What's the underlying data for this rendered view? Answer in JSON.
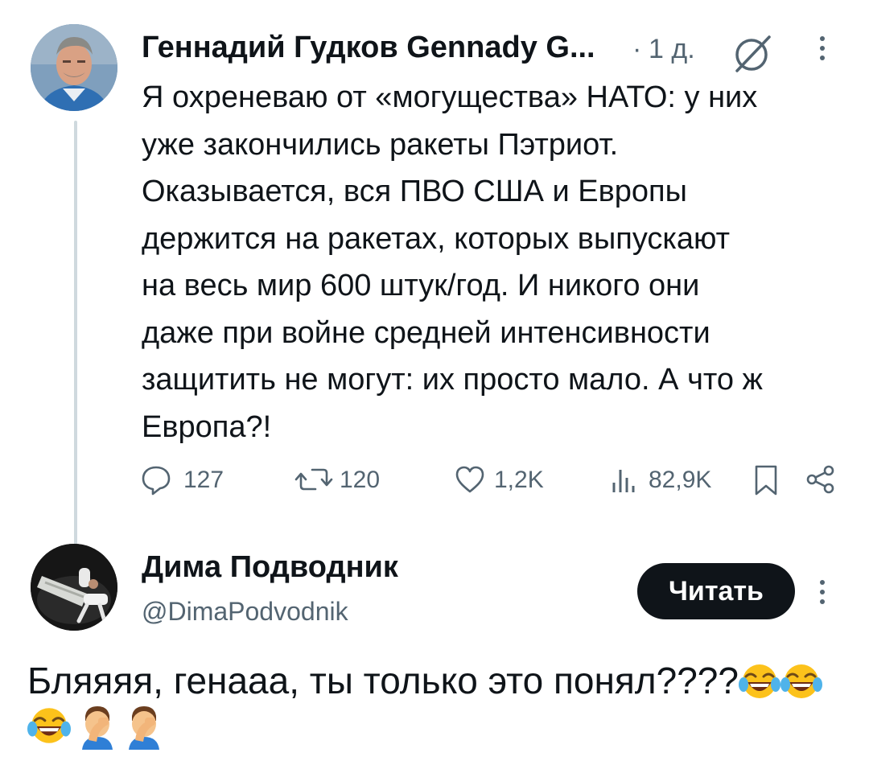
{
  "tweet": {
    "author_name": "Геннадий Гудков Gennady G...",
    "separator": "·",
    "time": "1 д.",
    "text_lines": [
      "Я охреневаю от «могущества» НАТО: у них",
      "уже закончились ракеты Пэтриот.",
      "Оказывается, вся ПВО США и Европы",
      "держится на ракетах, которых выпускают",
      "на весь мир 600 штук/год. И никого они",
      "даже при войне средней интенсивности",
      "защитить не могут: их просто мало.  А что ж",
      "Европа?!"
    ],
    "actions": {
      "replies": "127",
      "reposts": "120",
      "likes": "1,2K",
      "views": "82,9K"
    },
    "icons": {
      "grok": "grok-icon",
      "more": "more-vertical-icon",
      "reply": "reply-icon",
      "repost": "repost-icon",
      "like": "heart-icon",
      "views": "views-icon",
      "bookmark": "bookmark-icon",
      "share": "share-icon"
    }
  },
  "reply": {
    "author_name": "Дима Подводник",
    "handle": "@DimaPodvodnik",
    "follow_label": "Читать",
    "text": "Бляяяя, генааа, ты только это понял????",
    "emojis": [
      "face-with-tears-of-joy",
      "face-with-tears-of-joy",
      "face-with-tears-of-joy",
      "man-facepalming",
      "man-facepalming"
    ]
  },
  "colors": {
    "text": "#0f1419",
    "secondary": "#536471",
    "thread_line": "#cfd9de",
    "button_bg": "#0f1419"
  }
}
